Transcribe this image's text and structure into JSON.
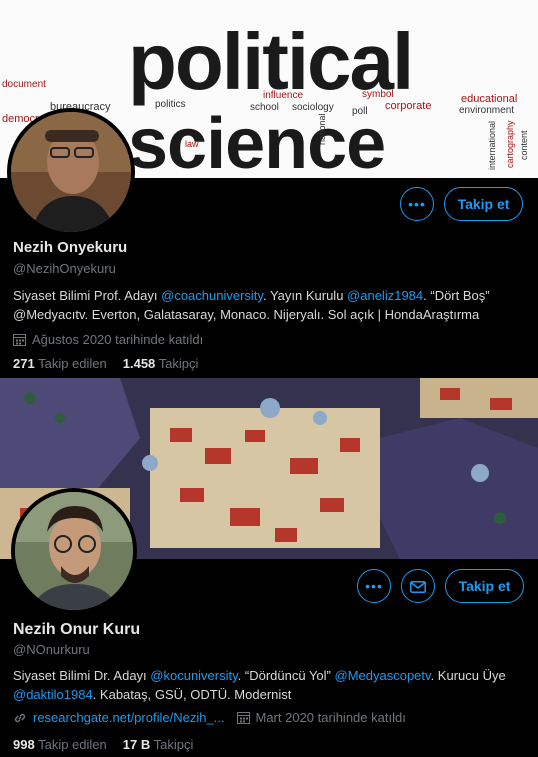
{
  "profiles": [
    {
      "banner_words": [
        "political",
        "science",
        "bureaucracy",
        "politics",
        "school",
        "sociology",
        "poll",
        "corporate",
        "educational",
        "environment",
        "influence",
        "symbol",
        "document",
        "democracy",
        "law",
        "national",
        "content",
        "international",
        "cartography"
      ],
      "name": "Nezih Onyekuru",
      "handle": "@NezihOnyekuru",
      "bio": [
        {
          "t": "Siyaset Bilimi Prof. Adayı "
        },
        {
          "t": "@coachuniversity",
          "link": true
        },
        {
          "t": ". Yayın Kurulu "
        },
        {
          "t": "@aneliz1984",
          "link": true
        },
        {
          "t": ". “Dört Boş” @Medyacıtv. Everton, Galatasaray, Monaco. Nijeryalı. Sol açık | HondaAraştırma"
        }
      ],
      "joined": "Ağustos 2020 tarihinde katıldı",
      "following_count": "271",
      "following_label": "Takip edilen",
      "followers_count": "1.458",
      "followers_label": "Takipçi",
      "follow_label": "Takip et"
    },
    {
      "name": "Nezih Onur Kuru",
      "handle": "@NOnurkuru",
      "bio": [
        {
          "t": "Siyaset Bilimi Dr. Adayı "
        },
        {
          "t": "@kocuniversity",
          "link": true
        },
        {
          "t": ". “Dördüncü Yol” "
        },
        {
          "t": "@Medyascopetv",
          "link": true
        },
        {
          "t": ". Kurucu Üye "
        },
        {
          "t": "@daktilo1984",
          "link": true
        },
        {
          "t": ". Kabataş, GSÜ, ODTÜ. Modernist"
        }
      ],
      "website": "researchgate.net/profile/Nezih_...",
      "joined": "Mart 2020 tarihinde katıldı",
      "following_count": "998",
      "following_label": "Takip edilen",
      "followers_count": "17 B",
      "followers_label": "Takipçi",
      "follow_label": "Takip et"
    }
  ],
  "colors": {
    "accent": "#1d9bf0",
    "background": "#000000",
    "muted": "#6e767d"
  },
  "icons": [
    "more-options-icon",
    "message-envelope-icon",
    "calendar-icon",
    "link-icon"
  ]
}
